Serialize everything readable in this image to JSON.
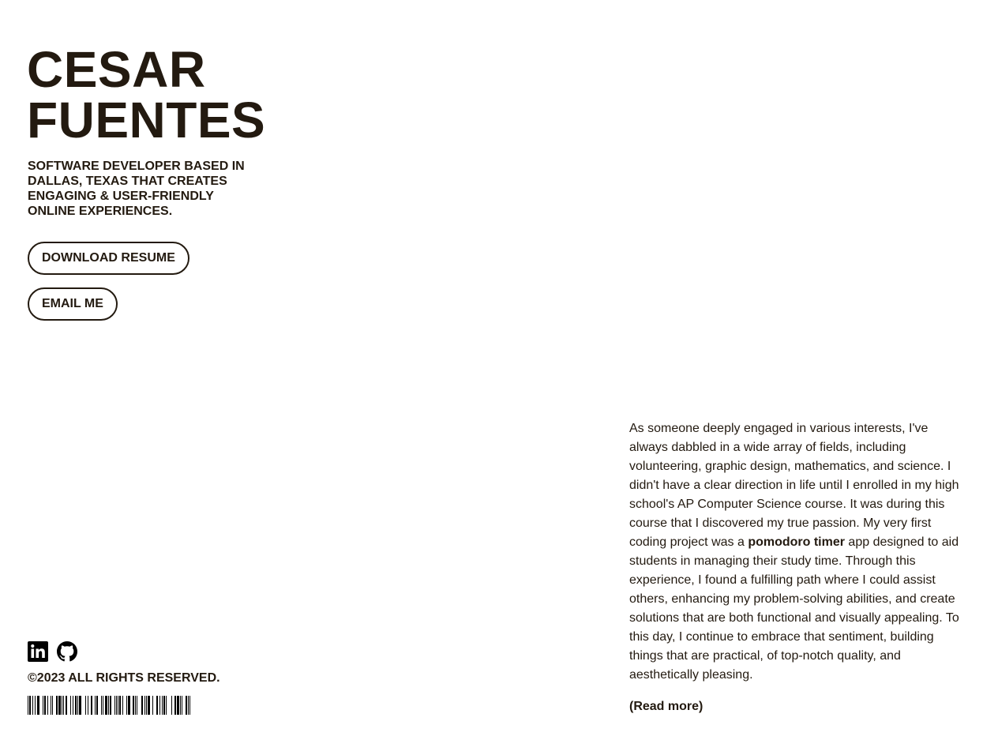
{
  "header": {
    "name_line1": "CESAR",
    "name_line2": "FUENTES"
  },
  "tagline": {
    "line1": "SOFTWARE DEVELOPER BASED IN",
    "line2": "DALLAS, TEXAS THAT CREATES",
    "line3": "ENGAGING & USER-FRIENDLY",
    "line4": "ONLINE EXPERIENCES."
  },
  "actions": {
    "download_resume": "DOWNLOAD RESUME",
    "email_me": "EMAIL ME"
  },
  "social": {
    "icons": [
      "linkedin-icon",
      "github-icon"
    ]
  },
  "footer": {
    "copyright": "©2023 ALL RIGHTS RESERVED."
  },
  "about": {
    "text_before": "As someone deeply engaged in various interests, I've always dabbled in a wide array of fields, including volunteering, graphic design, mathematics, and science. I didn't have a clear direction in life until I enrolled in my high school's AP Computer Science course. It was during this course that I discovered my true passion. My very first coding project was a ",
    "highlight": "pomodoro timer",
    "text_after": " app designed to aid students in managing their study time. Through this experience, I found a fulfilling path where I could assist others, enhancing my problem-solving abilities, and create solutions that are both functional and visually appealing. To this day, I continue to embrace that sentiment, building things that are practical, of top-notch quality, and aesthetically pleasing.",
    "read_more": "(Read more)"
  },
  "colors": {
    "text": "#231a10",
    "background": "#ffffff"
  }
}
